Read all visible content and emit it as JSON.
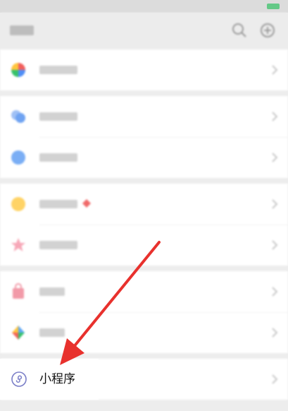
{
  "colors": {
    "arrow": "#e8312d",
    "miniprogram_icon": "#7a7ec7",
    "page_background": "#ededed"
  },
  "icons": {
    "header": [
      "search-icon",
      "add-icon"
    ],
    "rows": [
      "moments-icon",
      "channels-icon",
      "live-icon",
      "shake-icon",
      "top-stories-icon",
      "shopping-icon",
      "games-icon",
      "miniprogram-icon"
    ]
  },
  "discover": {
    "miniprogram": {
      "label": "小程序"
    }
  }
}
